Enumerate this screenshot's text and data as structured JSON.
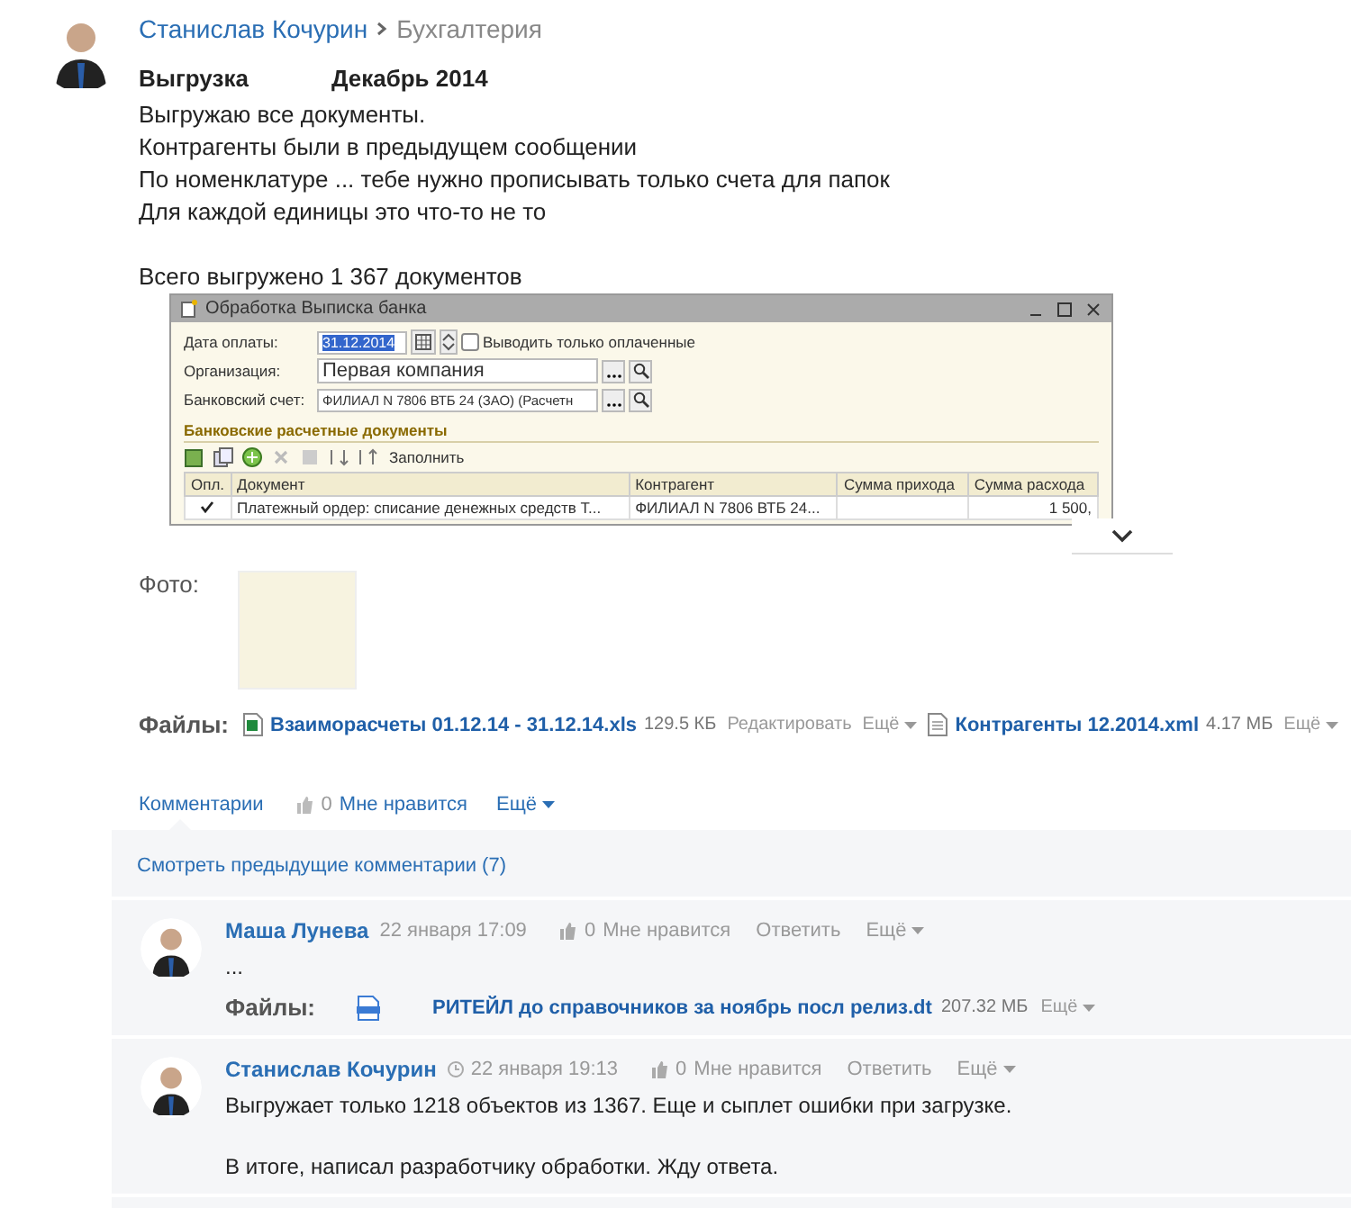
{
  "post": {
    "author": "Станислав Кочурин",
    "group": "Бухгалтерия",
    "title": "Выгрузка",
    "period": "Декабрь 2014",
    "body_lines": [
      "Выгружаю все документы.",
      "Контрагенты были в предыдущем сообщении",
      "По номенклатуре ... тебе нужно прописывать только счета для папок",
      "Для каждой единицы это что-то не то"
    ],
    "total": "Всего выгружено 1 367 документов",
    "window": {
      "title": "Обработка  Выписка банка",
      "fields": [
        {
          "kind": "date",
          "label": "Дата оплаты:",
          "value": "31.12.2014"
        },
        {
          "kind": "select",
          "label": "Организация:",
          "value": "Первая компания"
        },
        {
          "kind": "select",
          "label": "Банковский счет:",
          "value": "ФИЛИАЛ N 7806 ВТБ 24 (ЗАО) (Расчетн"
        }
      ],
      "checkbox": {
        "label": "Выводить только оплаченные",
        "checked": false
      },
      "section": "Банковские расчетные документы",
      "fill_button": "Заполнить",
      "columns": [
        "Опл.",
        "Документ",
        "Контрагент",
        "Сумма прихода",
        "Сумма расхода"
      ],
      "rows": [
        {
          "paid": true,
          "document": "Платежный ордер: списание денежных средств Т...",
          "counterparty": "ФИЛИАЛ N 7806 ВТБ 24...",
          "expense": "1 500,"
        }
      ]
    },
    "photo_label": "Фото:",
    "files_label": "Файлы:",
    "files": [
      {
        "kind": "xls",
        "name": "Взаиморасчеты 01.12.14 - 31.12.14.xls",
        "size": "129.5 КБ",
        "actions": [
          "Редактировать",
          "Ещё"
        ]
      },
      {
        "kind": "doc",
        "name": "Контрагенты 12.2014.xml",
        "size": "4.17 МБ",
        "actions": [
          "Ещё"
        ]
      }
    ],
    "comments_link": "Комментарии",
    "likes": "0",
    "like_label": "Мне нравится",
    "more": "Ещё"
  },
  "comments": {
    "previous": "Смотреть предыдущие комментарии (7)",
    "items": [
      {
        "author": "Маша Лунева",
        "time_icon": false,
        "time": "22 января 17:09",
        "likes": "0",
        "like_label": "Мне нравится",
        "reply": "Ответить",
        "more": "Ещё",
        "paragraphs": [
          "..."
        ],
        "files_label": "Файлы:",
        "files": [
          {
            "name": "РИТЕЙЛ до справочников за ноябрь посл релиз.dt",
            "size": "207.32 МБ",
            "more": "Ещё"
          }
        ]
      },
      {
        "author": "Станислав Кочурин",
        "time_icon": true,
        "time": "22 января 19:13",
        "likes": "0",
        "like_label": "Мне нравится",
        "reply": "Ответить",
        "more": "Ещё",
        "paragraphs": [
          "Выгружает только 1218 объектов из 1367. Еще и сыплет ошибки при загрузке.",
          "В итоге, написал разработчику обработки. Жду ответа."
        ]
      }
    ]
  }
}
